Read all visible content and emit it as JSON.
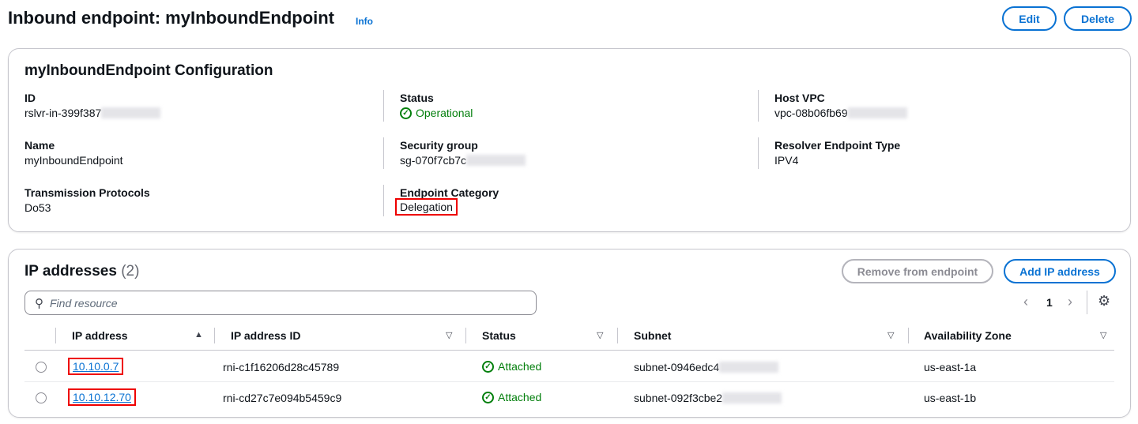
{
  "header": {
    "title": "Inbound endpoint: myInboundEndpoint",
    "info": "Info",
    "edit": "Edit",
    "delete": "Delete"
  },
  "config": {
    "title": "myInboundEndpoint Configuration",
    "id_label": "ID",
    "id_value": "rslvr-in-399f387",
    "status_label": "Status",
    "status_value": "Operational",
    "vpc_label": "Host VPC",
    "vpc_value": "vpc-08b06fb69",
    "name_label": "Name",
    "name_value": "myInboundEndpoint",
    "sg_label": "Security group",
    "sg_value": "sg-070f7cb7c",
    "type_label": "Resolver Endpoint Type",
    "type_value": "IPV4",
    "proto_label": "Transmission Protocols",
    "proto_value": "Do53",
    "cat_label": "Endpoint Category",
    "cat_value": "Delegation"
  },
  "ips": {
    "title": "IP addresses",
    "count": "(2)",
    "remove": "Remove from endpoint",
    "add": "Add IP address",
    "search_placeholder": "Find resource",
    "page": "1",
    "columns": [
      "IP address",
      "IP address ID",
      "Status",
      "Subnet",
      "Availability Zone"
    ],
    "rows": [
      {
        "ip": "10.10.0.7",
        "id": "rni-c1f16206d28c45789",
        "status": "Attached",
        "subnet": "subnet-0946edc4",
        "az": "us-east-1a"
      },
      {
        "ip": "10.10.12.70",
        "id": "rni-cd27c7e094b5459c9",
        "status": "Attached",
        "subnet": "subnet-092f3cbe2",
        "az": "us-east-1b"
      }
    ]
  },
  "colors": {
    "accent": "#0972d3",
    "success": "#037f0c",
    "highlight": "#e00000"
  }
}
